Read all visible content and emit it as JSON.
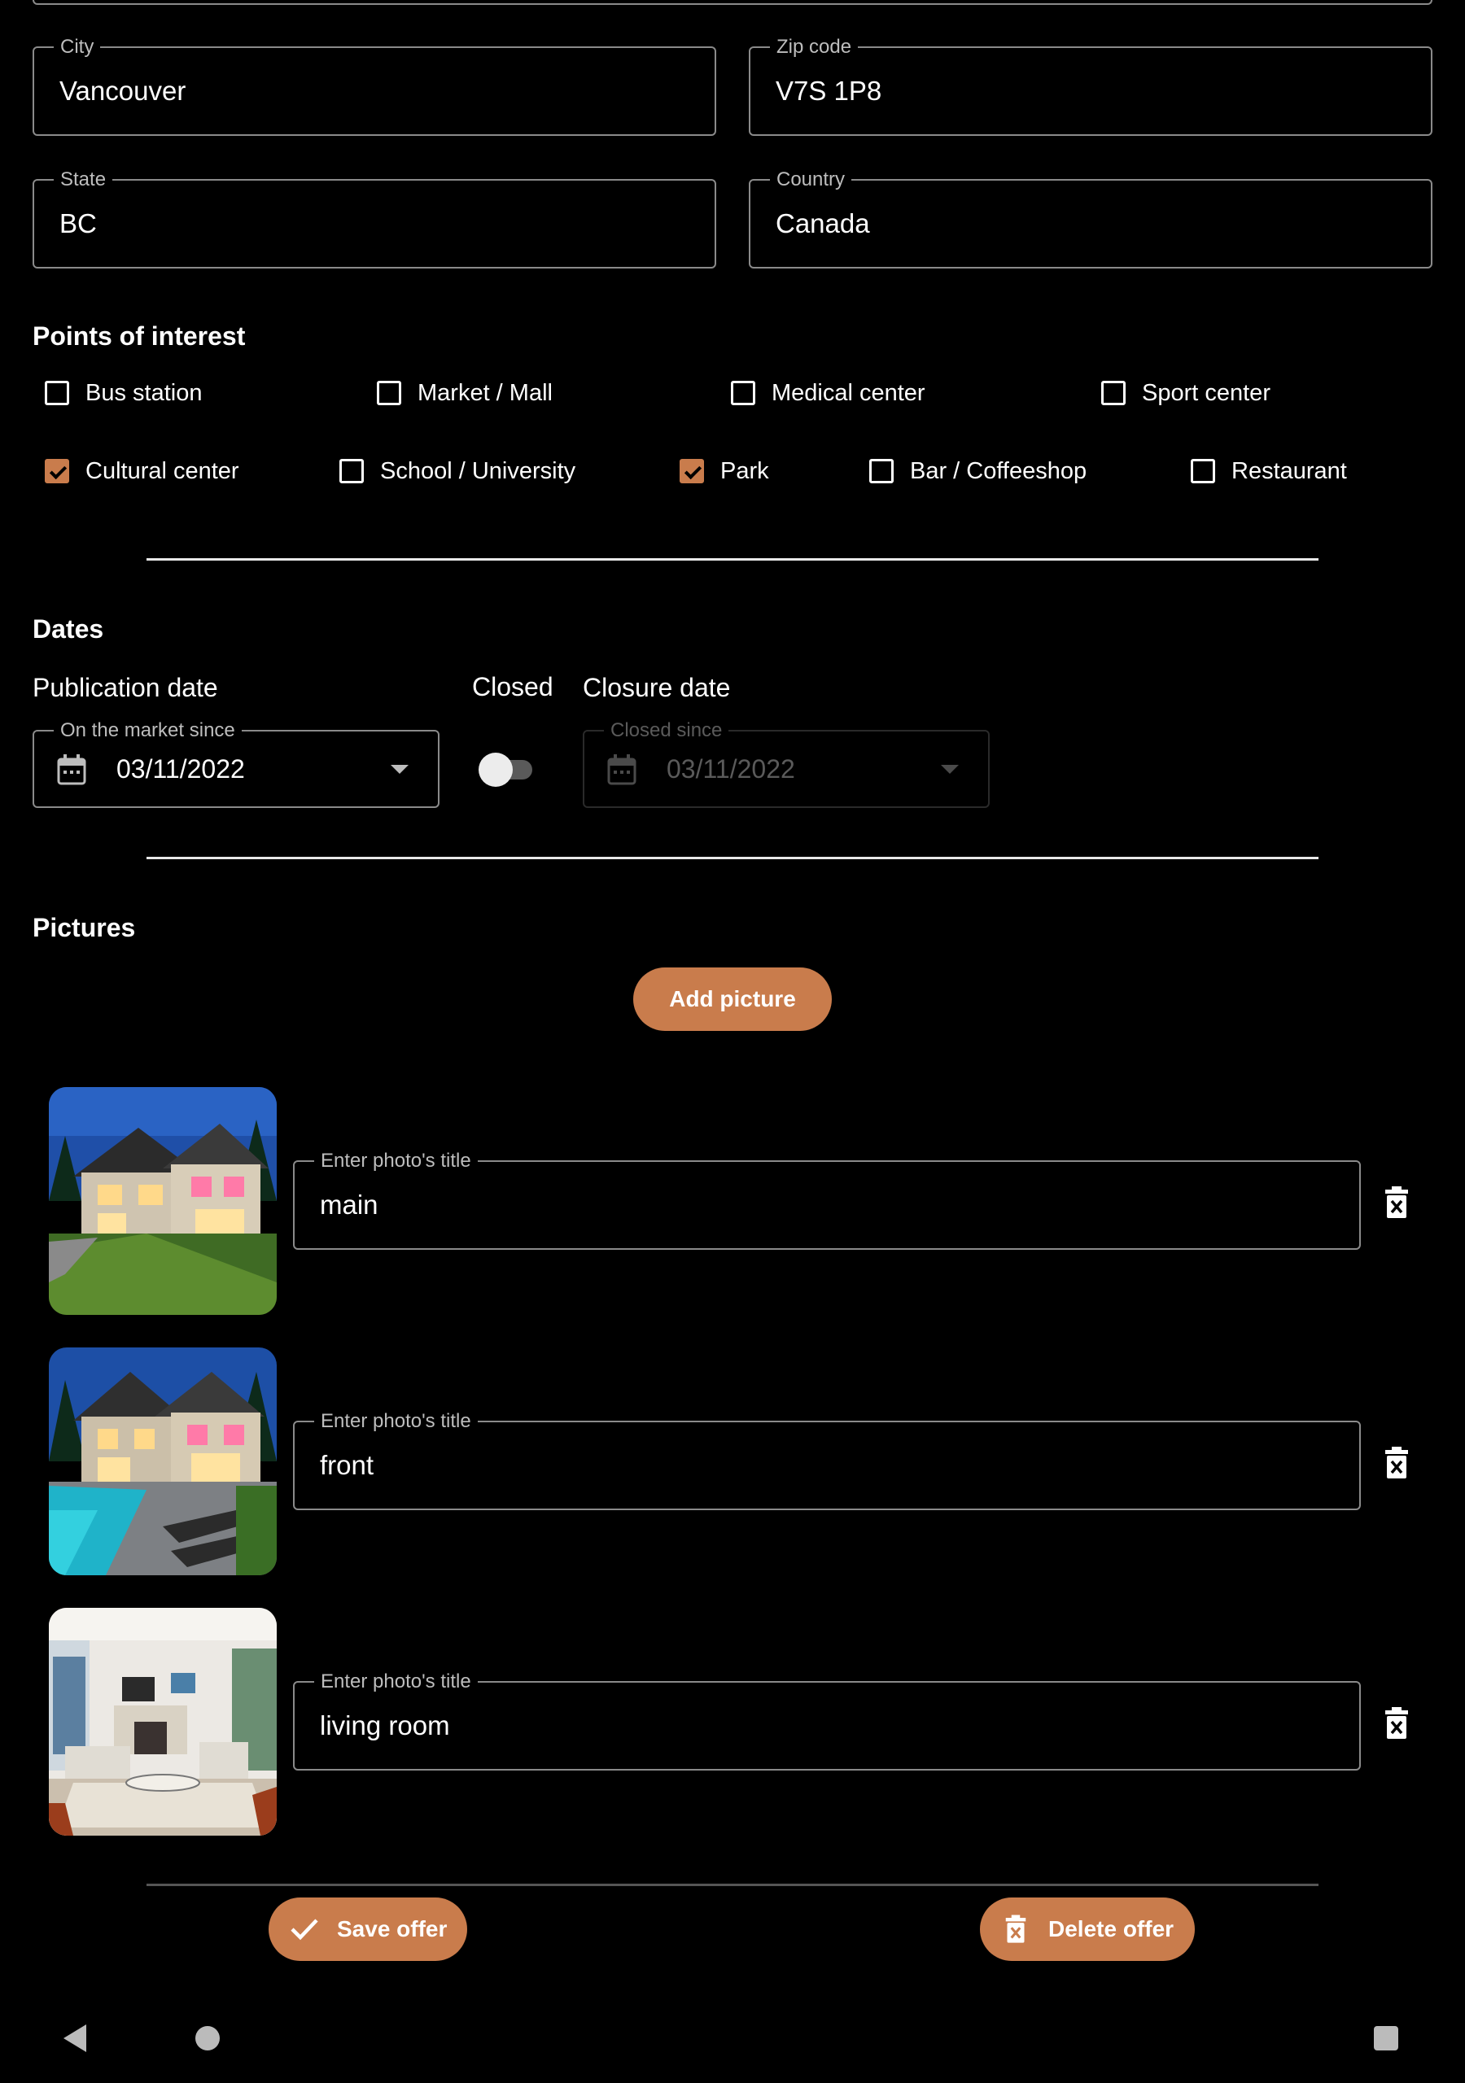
{
  "address": {
    "city": {
      "label": "City",
      "value": "Vancouver"
    },
    "zip": {
      "label": "Zip code",
      "value": "V7S 1P8"
    },
    "state": {
      "label": "State",
      "value": "BC"
    },
    "country": {
      "label": "Country",
      "value": "Canada"
    }
  },
  "points_of_interest": {
    "title": "Points of interest",
    "items": [
      {
        "label": "Bus station",
        "checked": false
      },
      {
        "label": "Market / Mall",
        "checked": false
      },
      {
        "label": "Medical center",
        "checked": false
      },
      {
        "label": "Sport center",
        "checked": false
      },
      {
        "label": "Cultural center",
        "checked": true
      },
      {
        "label": "School / University",
        "checked": false
      },
      {
        "label": "Park",
        "checked": true
      },
      {
        "label": "Bar / Coffeeshop",
        "checked": false
      },
      {
        "label": "Restaurant",
        "checked": false
      }
    ]
  },
  "dates": {
    "title": "Dates",
    "publication_label": "Publication date",
    "closed_label": "Closed",
    "closed": false,
    "closure_label": "Closure date",
    "market_since": {
      "label": "On the market since",
      "value": "03/11/2022"
    },
    "closed_since": {
      "label": "Closed since",
      "value": "03/11/2022"
    }
  },
  "pictures": {
    "title": "Pictures",
    "add_label": "Add picture",
    "items": [
      {
        "field_label": "Enter photo's title",
        "title": "main"
      },
      {
        "field_label": "Enter photo's title",
        "title": "front"
      },
      {
        "field_label": "Enter photo's title",
        "title": "living room"
      }
    ]
  },
  "actions": {
    "save_label": "Save offer",
    "delete_label": "Delete offer"
  },
  "colors": {
    "accent": "#c97c4c",
    "background": "#000000",
    "outline": "#8a8a8a"
  }
}
